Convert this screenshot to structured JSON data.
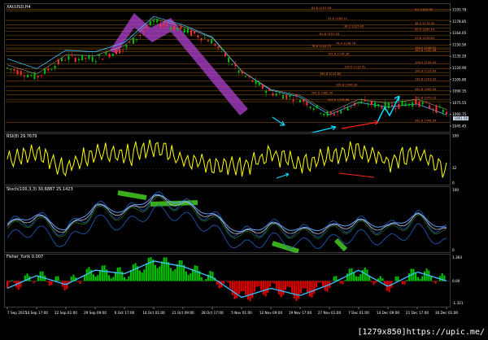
{
  "window": {
    "symbol_label": "XAUUSD,H4",
    "footer_text": "[1279x850]https://upic.me/"
  },
  "panes": {
    "price": {
      "label": "XAUUSD,H4",
      "current_price": "1061.56",
      "y_ticks": [
        "1193.78",
        "1178.85",
        "1164.65",
        "1150.50",
        "1135.20",
        "1120.90",
        "1105.80",
        "1090.35",
        "1075.55",
        "1060.75",
        "1045.45"
      ],
      "fib_labels": [
        {
          "text": "61.8 1197.96",
          "price": 1196
        },
        {
          "text": "0.0 1193.78",
          "price": 1194
        },
        {
          "text": "23.6 1182.51",
          "price": 1182
        },
        {
          "text": "38.2 1173.30",
          "price": 1176
        },
        {
          "text": "38.2 1167.46",
          "price": 1172
        },
        {
          "text": "50.0 1167.14",
          "price": 1168
        },
        {
          "text": "61.8 1157.58",
          "price": 1162
        },
        {
          "text": "23.6 1153.83",
          "price": 1157
        },
        {
          "text": "76.4 1146.76",
          "price": 1150
        },
        {
          "text": "100.0 1139.91",
          "price": 1144
        },
        {
          "text": "78.6 1143.72",
          "price": 1146
        },
        {
          "text": "161.8 1142.36",
          "price": 1141
        },
        {
          "text": "161.8 1136.36",
          "price": 1136
        },
        {
          "text": "100.0 1128.00",
          "price": 1125
        },
        {
          "text": "100.0 1119.41",
          "price": 1119
        },
        {
          "text": "161.8 1115.95",
          "price": 1114
        },
        {
          "text": "161.8 1111.82",
          "price": 1110
        },
        {
          "text": "161.8 1103.20",
          "price": 1103
        },
        {
          "text": "261.8 1096.33",
          "price": 1096
        },
        {
          "text": "261.8 1090.33",
          "price": 1090
        },
        {
          "text": "261.8 1085.40",
          "price": 1085
        },
        {
          "text": "261.8 1079.23",
          "price": 1079
        },
        {
          "text": "200.0 1078.68",
          "price": 1076
        },
        {
          "text": "261.8 1048.56",
          "price": 1049
        }
      ]
    },
    "rsi": {
      "label": "RSI(8) 29.7679",
      "y_ticks": [
        "100",
        "32",
        "0"
      ]
    },
    "stoch": {
      "label": "Stoch(100,3,3) 30.6887 25.1423",
      "y_ticks": [
        "100",
        "0"
      ]
    },
    "fisher": {
      "label": "Fisher_Yurik 0.007",
      "y_ticks": [
        "1.364",
        "0.00",
        "-1.321"
      ]
    }
  },
  "time_axis": [
    "7 Sep 2015",
    "14 Sep 17:00",
    "22 Sep 01:00",
    "29 Sep 09:00",
    "6 Oct 17:00",
    "14 Oct 01:00",
    "21 Oct 09:00",
    "28 Oct 17:00",
    "5 Nov 01:00",
    "12 Nov 09:00",
    "19 Nov 17:00",
    "27 Nov 01:00",
    "7 Dec 01:00",
    "14 Dec 09:00",
    "21 Dec 17:00",
    "30 Dec 01:00"
  ],
  "colors": {
    "candle_up": "#00c000",
    "candle_down": "#ff3030",
    "fib_line": "#d08000",
    "rsi_line": "#ffff00",
    "fisher_up": "#00c000",
    "fisher_down": "#e00000",
    "fisher_line": "#40c0ff",
    "annotation_purple": "#b040d0",
    "annotation_cyan": "#00e0ff",
    "annotation_green": "#40c020",
    "annotation_red": "#ff2020"
  },
  "chart_data": {
    "type": "line",
    "title": "XAUUSD,H4",
    "x": [
      "7 Sep 2015",
      "14 Sep 17:00",
      "22 Sep 01:00",
      "29 Sep 09:00",
      "6 Oct 17:00",
      "14 Oct 01:00",
      "21 Oct 09:00",
      "28 Oct 17:00",
      "5 Nov 01:00",
      "12 Nov 09:00",
      "19 Nov 17:00",
      "27 Nov 01:00",
      "7 Dec 01:00",
      "14 Dec 09:00",
      "21 Dec 17:00",
      "30 Dec 01:00"
    ],
    "series": [
      {
        "values": [
          1120,
          1108,
          1133,
          1132,
          1145,
          1180,
          1170,
          1155,
          1112,
          1088,
          1080,
          1058,
          1075,
          1070,
          1075,
          1062
        ]
      }
    ],
    "ylim": [
      1040,
      1200
    ],
    "rsi": {
      "values": [
        45,
        70,
        30,
        65,
        55,
        78,
        50,
        40,
        35,
        60,
        40,
        55,
        70,
        45,
        65,
        30
      ],
      "ylim": [
        0,
        100
      ]
    },
    "stoch": {
      "values": [
        40,
        55,
        30,
        70,
        60,
        85,
        75,
        55,
        25,
        40,
        30,
        35,
        45,
        35,
        55,
        31
      ],
      "ylim": [
        0,
        100
      ]
    },
    "fisher": {
      "values": [
        -0.4,
        0.3,
        -0.2,
        0.6,
        0.4,
        1.1,
        0.8,
        0.2,
        -0.9,
        -0.4,
        -0.8,
        -0.2,
        0.6,
        -0.3,
        0.5,
        0.007
      ],
      "ylim": [
        -1.321,
        1.364
      ]
    }
  }
}
